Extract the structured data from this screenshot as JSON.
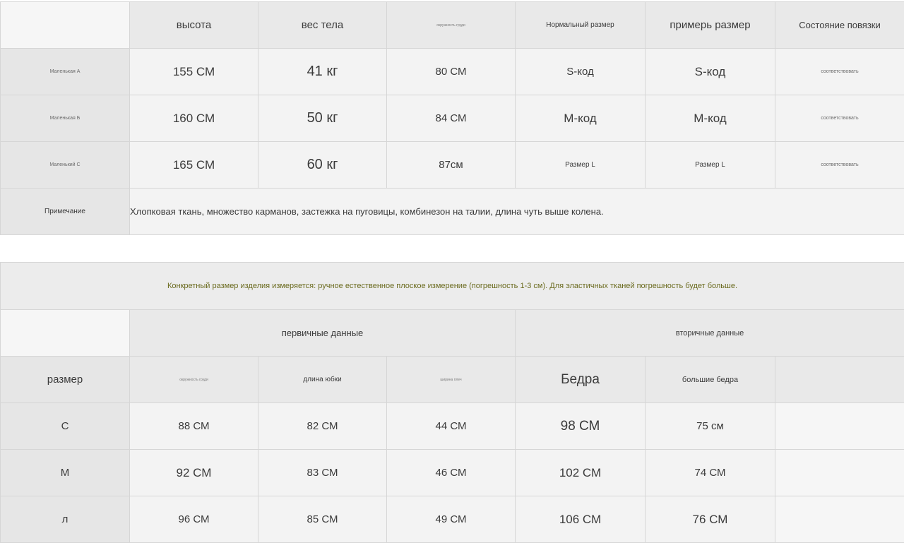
{
  "table1": {
    "headers": [
      "",
      "высота",
      "вес тела",
      "окружность груди",
      "Нормальный размер",
      "примерь размер",
      "Состояние повязки"
    ],
    "rows": [
      {
        "label": "Маленькая A",
        "height": "155 СМ",
        "weight": "41 кг",
        "chest": "80 СМ",
        "normal_size": "S-код",
        "fit_size": "S-код",
        "status": "соответствовать"
      },
      {
        "label": "Маленькая Б",
        "height": "160 СМ",
        "weight": "50 кг",
        "chest": "84 СМ",
        "normal_size": "М-код",
        "fit_size": "М-код",
        "status": "соответствовать"
      },
      {
        "label": "Маленький С",
        "height": "165 СМ",
        "weight": "60 кг",
        "chest": "87см",
        "normal_size": "Размер L",
        "fit_size": "Размер L",
        "status": "соответствовать"
      }
    ],
    "note_label": "Примечание",
    "note_text": "Хлопковая ткань, множество карманов, застежка на пуговицы, комбинезон на талии, длина чуть выше колена."
  },
  "table2": {
    "notice": "Конкретный размер изделия измеряется: ручное естественное плоское измерение (погрешность 1-3 см). Для эластичных тканей погрешность будет больше.",
    "group_primary": "первичные данные",
    "group_secondary": "вторичные данные",
    "size_label": "размер",
    "subheaders": [
      "окружность груди",
      "длина юбки",
      "ширина плеч",
      "Бедра",
      "большие бедра",
      ""
    ],
    "rows": [
      {
        "size": "С",
        "chest": "88 СМ",
        "skirt": "82 СМ",
        "shoulder": "44 СМ",
        "hips": "98 СМ",
        "thigh": "75 см"
      },
      {
        "size": "М",
        "chest": "92 СМ",
        "skirt": "83 СМ",
        "shoulder": "46 СМ",
        "hips": "102 СМ",
        "thigh": "74 СМ"
      },
      {
        "size": "л",
        "chest": "96 СМ",
        "skirt": "85 СМ",
        "shoulder": "49 СМ",
        "hips": "106 СМ",
        "thigh": "76 СМ"
      }
    ]
  }
}
